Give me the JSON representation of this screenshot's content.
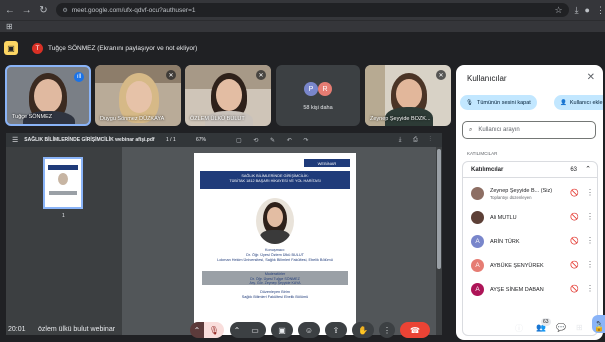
{
  "browser": {
    "url": "meet.google.com/ufx-qdvf-ocu?authuser=1",
    "nav": {
      "back": "←",
      "forward": "→",
      "reload": "↻"
    }
  },
  "presenting_banner": {
    "avatar_letter": "T",
    "text": "Tuğçe SÖNMEZ (Ekranını paylaşıyor ve not ekliyor)"
  },
  "tiles": [
    {
      "name": "Tuğçe SÖNMEZ",
      "speaking": true
    },
    {
      "name": "Duygu Sönmez DÜZKAYA",
      "speaking": false
    },
    {
      "name": "ÖZLEM ÜLKÜ BULUT",
      "speaking": false
    },
    {
      "name": "Zeynep Şeyyide BOZK...",
      "speaking": false
    }
  ],
  "more_tile": {
    "label": "58 kişi daha",
    "avatars": [
      "P",
      "R",
      "S"
    ]
  },
  "pdf": {
    "filename": "SAĞLIK BİLİMLERİNDE GİRİŞİMCİLİK webinar afişi.pdf",
    "page_indicator": "1 / 1",
    "zoom": "67%",
    "thumb_number": "1",
    "page": {
      "header": "WEBİNAR",
      "title_line1": "SAĞLIK BİLİMLERİNDE GİRİŞİMCİLİK:",
      "title_line2": "TÜBİTAK 1812 BAŞARI HİKAYESİ VE YOL HARİTASI",
      "speaker_label": "Konuşmacı:",
      "speaker_name": "Dr. Öğr. Üyesi Özlem Ülkü BULUT",
      "speaker_affiliation": "Lokman Hekim Üniversitesi, Sağlık Bilimleri Fakültesi, Ebelik Bölümü",
      "moderators_label": "Moderatörler",
      "moderator1": "Dr. Öğr. Üyesi Tuğçe SÖNMEZ",
      "moderator2": "Arş. Gör. Zeynep Şeyyide KAYA",
      "organizer_label": "Düzenleyen Birim",
      "organizer": "Sağlık Bilimleri Fakültesi Ebelik Bölümü"
    }
  },
  "panel": {
    "title": "Kullanıcılar",
    "mute_all": "Tümünün sesini kapat",
    "add_people": "Kullanıcı ekle",
    "search_placeholder": "Kullanıcı arayın",
    "section_label": "KATILIMCILAR",
    "group_label": "Katılımcılar",
    "group_count": "63",
    "participants": [
      {
        "name": "Zeynep Şeyyide B... (Siz)",
        "sub": "Toplantıyı düzenleyen",
        "avatar": "",
        "color": "#8d6e63"
      },
      {
        "name": "Ali MUTLU",
        "sub": "",
        "avatar": "",
        "color": "#5d4037"
      },
      {
        "name": "ARİN TÜRK",
        "sub": "",
        "avatar": "A",
        "color": "#7986cb"
      },
      {
        "name": "AYBÜKE ŞENYÜREK",
        "sub": "",
        "avatar": "A",
        "color": "#e67c73"
      },
      {
        "name": "AYŞE SİNEM DABAN",
        "sub": "",
        "avatar": "A",
        "color": "#ad1457"
      }
    ]
  },
  "bottom_bar": {
    "time": "20:01",
    "meeting_name": "özlem ülkü bulut webinar",
    "people_badge": "63"
  },
  "colors": {
    "accent": "#1a73e8",
    "end_call": "#ea4335",
    "pill": "#c2e7ff",
    "bg": "#202124"
  }
}
